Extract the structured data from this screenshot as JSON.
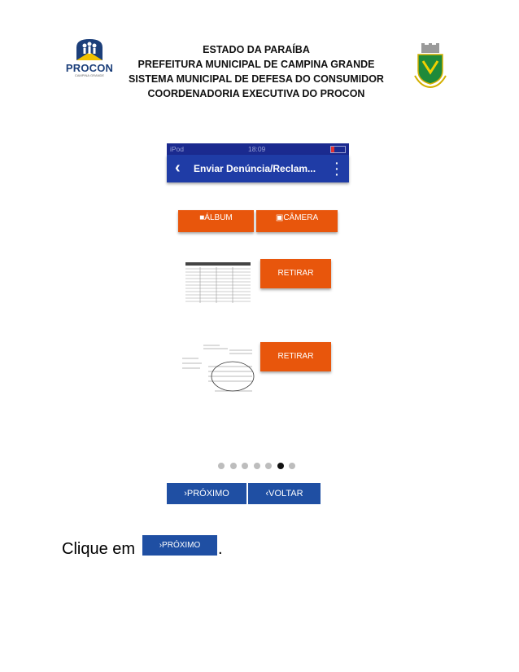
{
  "header": {
    "line1": "ESTADO DA PARAÍBA",
    "line2": "PREFEITURA MUNICIPAL DE CAMPINA GRANDE",
    "line3": "SISTEMA MUNICIPAL DE DEFESA DO CONSUMIDOR",
    "line4": "COORDENADORIA EXECUTIVA DO PROCON",
    "logo_text": "PROCON",
    "logo_sub": "CAMPINA GRANDE"
  },
  "phone": {
    "status_device": "iPod",
    "status_time": "18:09",
    "title": "Enviar Denúncia/Reclam...",
    "album_label": "ÁLBUM",
    "camera_label": "CÂMERA",
    "remove_label_1": "RETIRAR",
    "remove_label_2": "RETIRAR"
  },
  "pagination": {
    "total": 7,
    "active_index": 5
  },
  "nav": {
    "next_label": "PRÓXIMO",
    "back_label": "VOLTAR"
  },
  "instruction": {
    "text": "Clique em",
    "button_label": "PRÓXIMO",
    "suffix": "."
  },
  "colors": {
    "orange": "#e8560c",
    "blue": "#1f4fa3",
    "navy_bar": "#1f3ca6"
  }
}
